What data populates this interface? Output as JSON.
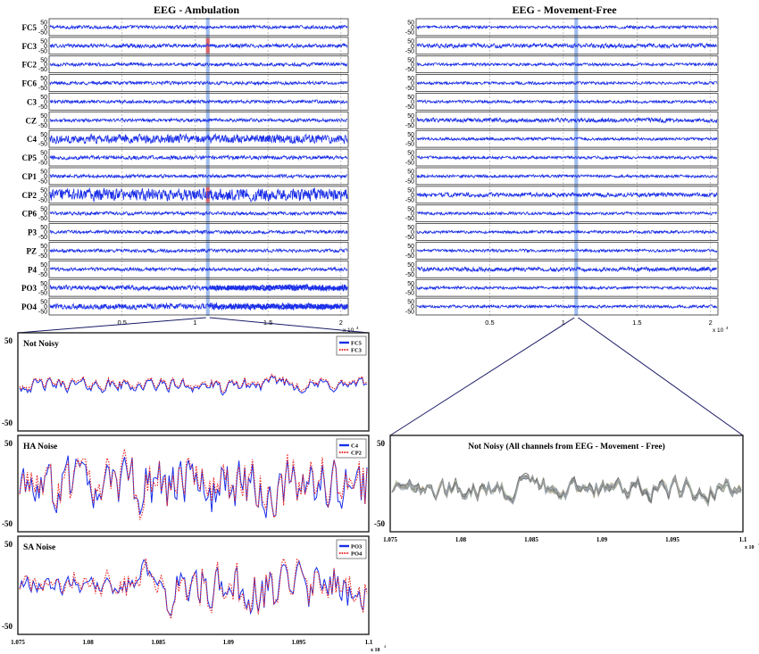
{
  "figure": {
    "left_panel_title": "EEG - Ambulation",
    "right_panel_title": "EEG - Movement-Free"
  },
  "chart_data": [
    {
      "id": "ambulation",
      "type": "line",
      "title": "EEG - Ambulation",
      "channels": [
        "FC5",
        "FC3",
        "FC2",
        "FC6",
        "C3",
        "CZ",
        "C4",
        "CP5",
        "CP1",
        "CP2",
        "CP6",
        "P3",
        "PZ",
        "P4",
        "PO3",
        "PO4"
      ],
      "yticks": [
        "50",
        "0",
        "-50"
      ],
      "ylim": [
        -50,
        50
      ],
      "xlim": [
        0,
        20500
      ],
      "xticks": [
        "0.5",
        "1",
        "1.5",
        "2"
      ],
      "xtick_values": [
        5000,
        10000,
        15000,
        20000
      ],
      "x_exponent": "x 10",
      "x_exponent_power": "4",
      "highlight_window": [
        10750,
        11000
      ],
      "channel_amplitude": [
        7,
        8,
        7,
        7,
        7,
        7,
        18,
        8,
        7,
        26,
        7,
        7,
        7,
        7,
        10,
        12
      ],
      "red_marked_channels": [
        "FC3",
        "CP2"
      ],
      "grid": true
    },
    {
      "id": "movement_free",
      "type": "line",
      "title": "EEG - Movement-Free",
      "yticks": [
        "50",
        "0",
        "-50"
      ],
      "ylim": [
        -50,
        50
      ],
      "xlim": [
        0,
        20500
      ],
      "xticks": [
        "0.5",
        "1",
        "1.5",
        "2"
      ],
      "xtick_values": [
        5000,
        10000,
        15000,
        20000
      ],
      "x_exponent": "x 10",
      "x_exponent_power": "4",
      "highlight_window": [
        10750,
        11000
      ],
      "channel_count": 16,
      "grid": true
    },
    {
      "id": "not_noisy",
      "type": "line",
      "title": "Not Noisy",
      "series": [
        {
          "name": "FC5",
          "color": "#1a2ee8",
          "style": "solid"
        },
        {
          "name": "FC3",
          "color": "#e82020",
          "style": "dotted"
        }
      ],
      "yticks": [
        "50",
        "-50"
      ],
      "ylim": [
        -60,
        60
      ],
      "xlim": [
        10750,
        11000
      ],
      "grid": false
    },
    {
      "id": "ha_noise",
      "type": "line",
      "title": "HA Noise",
      "series": [
        {
          "name": "C4",
          "color": "#1a2ee8",
          "style": "solid"
        },
        {
          "name": "CP2",
          "color": "#e82020",
          "style": "dotted"
        }
      ],
      "yticks": [
        "50",
        "-50"
      ],
      "ylim": [
        -60,
        60
      ],
      "xlim": [
        10750,
        11000
      ],
      "grid": false
    },
    {
      "id": "sa_noise",
      "type": "line",
      "title": "SA Noise",
      "series": [
        {
          "name": "PO3",
          "color": "#1a2ee8",
          "style": "solid"
        },
        {
          "name": "PO4",
          "color": "#e82020",
          "style": "dotted"
        }
      ],
      "yticks": [
        "50",
        "-50"
      ],
      "ylim": [
        -60,
        60
      ],
      "xlim": [
        10750,
        11000
      ],
      "xticks": [
        "1.075",
        "1.08",
        "1.085",
        "1.09",
        "1.095",
        "1.1"
      ],
      "xtick_values": [
        10750,
        10800,
        10850,
        10900,
        10950,
        11000
      ],
      "x_exponent": "x 10",
      "x_exponent_power": "4",
      "grid": false
    },
    {
      "id": "movement_free_zoom",
      "type": "line",
      "title": "Not Noisy (All channels from EEG - Movement - Free)",
      "yticks": [
        "50",
        "-50"
      ],
      "ylim": [
        -60,
        60
      ],
      "xlim": [
        10750,
        11000
      ],
      "xticks": [
        "1.075",
        "1.08",
        "1.085",
        "1.09",
        "1.095",
        "1.1"
      ],
      "xtick_values": [
        10750,
        10800,
        10850,
        10900,
        10950,
        11000
      ],
      "x_exponent": "x 10",
      "x_exponent_power": "4",
      "channel_count": 16,
      "grid": false
    }
  ]
}
